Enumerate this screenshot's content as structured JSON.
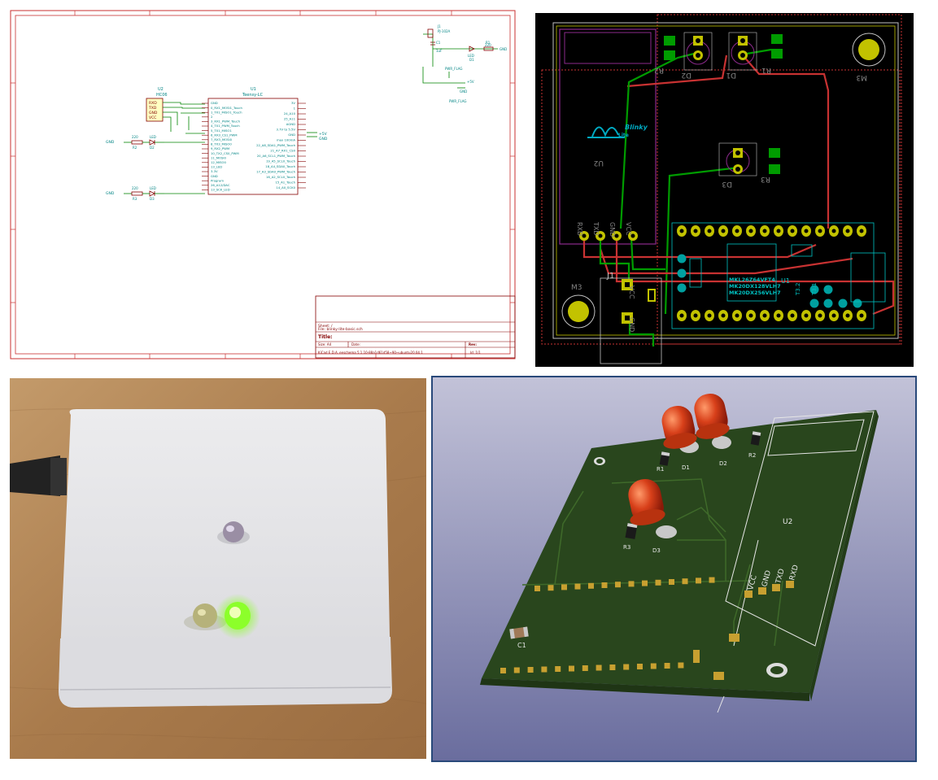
{
  "schematic": {
    "title_block": {
      "sheet": "Sheet: /",
      "file": "File: blinky-lite-basic.sch",
      "title": "Title:",
      "size": "Size: A4",
      "date": "Date:",
      "rev": "Rev:",
      "kicad": "KiCad E.D.A.  eeschema 5.1.10-88a1d61d58~90~ubuntu20.04.1",
      "id": "Id: 1/1"
    },
    "ref_u1": "U1",
    "val_u1": "Teensy-LC",
    "ref_u2": "U2",
    "val_u2": "HC06",
    "u2_pins": [
      "RXD",
      "TXD",
      "GND",
      "VCC"
    ],
    "u1_left_pins": [
      "GND",
      "0_RX1_MOSI1_Touch",
      "1_TX1_MISO1_Touch",
      "2",
      "3_RX1_PWM_Touch",
      "4_TX1_PWM_Touch",
      "5_TX1_MISO1",
      "6_RX3_CS1_PWM",
      "7_RX3_MOSI0",
      "8_TX3_MISO0",
      "9_RX2_PWM",
      "10_TX2_CS0_PWM",
      "11_MOSI0",
      "12_MISO0",
      "13_LED",
      "3.3V",
      "GND",
      "Program",
      "26_A12/DAC",
      "13_SCK_LED"
    ],
    "u1_right_pins": [
      "3V",
      "1",
      "24_A10",
      "25_A11",
      "AGND",
      "3.7V to 5.5V",
      "GND",
      "max 100mA",
      "22_A8_SDA1_PWM_Touch",
      "21_A7_RX1_CS0",
      "20_A6_SCL1_PWM_Touch",
      "19_A5_SCL0_Touch",
      "18_A4_SDA0_Touch",
      "17_A3_SDA0_PWM_Touch",
      "16_A2_SCL0_Touch",
      "15_A1_Touch",
      "14_A0_SCK0"
    ],
    "r_labels": [
      "220",
      "R2",
      "220",
      "R3"
    ],
    "led_labels": [
      "D2",
      "LED",
      "D3",
      "LED"
    ],
    "gnd_label": "GND",
    "j1_label": "J1",
    "j1_val": "PJ-102A",
    "c1_label": "C1",
    "c1_val": "1uF",
    "d1_label": "D1",
    "d1_val": "LED",
    "r1_label": "R1",
    "r1_val": "220",
    "pwr_flag": "PWR_FLAG",
    "vplus": "+5V"
  },
  "pcb": {
    "refs": {
      "r2": "R2",
      "d2": "D2",
      "d1": "D1",
      "r1": "R1",
      "m3a": "M3",
      "m3b": "M3",
      "u2": "U2",
      "d3": "D3",
      "r3": "R3",
      "j1": "J1",
      "u1": "U1"
    },
    "logo_line1": "Blinky",
    "logo_line2": "Lite",
    "hc06_pins": [
      "RXD",
      "TXD",
      "GND",
      "VCC"
    ],
    "j1_pins": [
      "VCC",
      "GND"
    ],
    "chip_lines": [
      "MKL26Z64VFT4",
      "MK20DX128VLH7",
      "MK20DX256VLH7"
    ],
    "t_labels": [
      "T3.2",
      "T3.1"
    ]
  },
  "board3d": {
    "refs": [
      "R1",
      "D1",
      "D2",
      "R2",
      "R3",
      "D3",
      "U2",
      "C1"
    ],
    "hc06_pins": [
      "VCC",
      "GND",
      "TXD",
      "RXD"
    ]
  },
  "colors": {
    "sch_border": "#c83232",
    "sch_wire": "#008400",
    "sch_part": "#840000",
    "sch_text": "#008484",
    "pcb_bg": "#000000",
    "f_cu": "#c83232",
    "b_cu": "#009c00",
    "pad": "#c2c200",
    "silk": "#00c2c2",
    "pcb_text": "#848484",
    "board_green": "#29461d",
    "led_red": "#cc3218",
    "led_green": "#7cff20"
  }
}
